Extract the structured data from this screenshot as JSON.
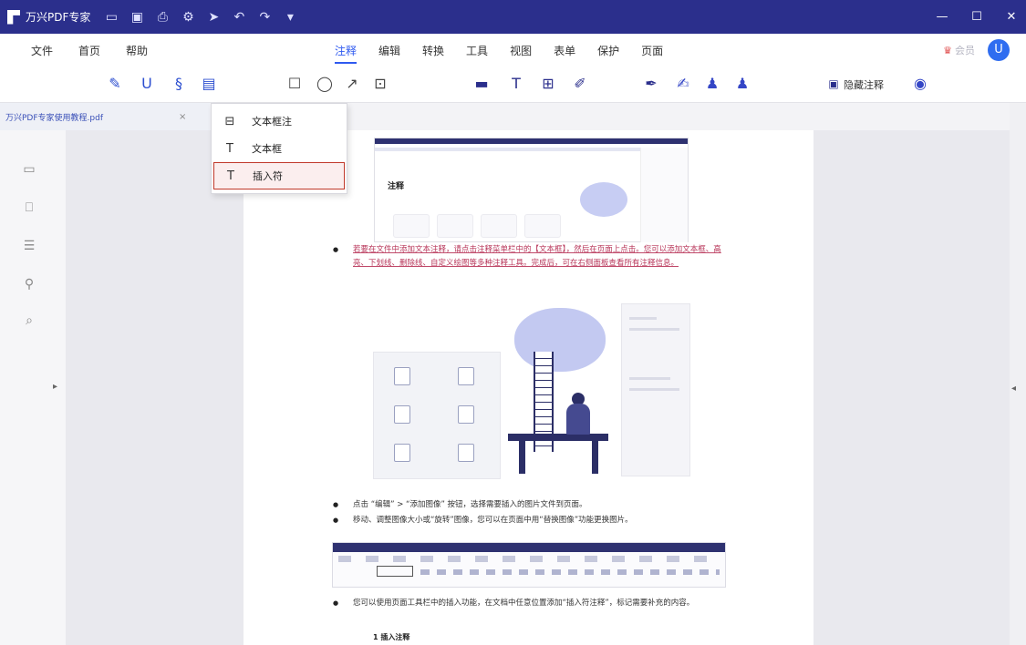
{
  "titlebar": {
    "app_name": "万兴PDF专家",
    "quick_access": [
      {
        "icon": "open-file-icon",
        "glyph": "▭"
      },
      {
        "icon": "save-icon",
        "glyph": "▣"
      },
      {
        "icon": "print-icon",
        "glyph": "⎙"
      },
      {
        "icon": "settings-icon",
        "glyph": "⚙"
      },
      {
        "icon": "share-icon",
        "glyph": "➤"
      },
      {
        "icon": "undo-icon",
        "glyph": "↶"
      },
      {
        "icon": "redo-icon",
        "glyph": "↷"
      },
      {
        "icon": "dropdown-icon",
        "glyph": "▾"
      }
    ],
    "window_controls": {
      "minimize": "—",
      "maximize": "☐",
      "close": "✕"
    }
  },
  "menubar": {
    "left": [
      "文件",
      "首页",
      "帮助"
    ],
    "tabs": [
      {
        "label": "注释",
        "active": true
      },
      {
        "label": "编辑",
        "active": false
      },
      {
        "label": "转换",
        "active": false
      },
      {
        "label": "工具",
        "active": false
      },
      {
        "label": "视图",
        "active": false
      },
      {
        "label": "表单",
        "active": false
      },
      {
        "label": "保护",
        "active": false
      },
      {
        "label": "页面",
        "active": false
      }
    ],
    "vip_label": "会员",
    "user_initial": "U"
  },
  "toolbar": {
    "icons": [
      {
        "name": "highlight-icon",
        "glyph": "✎"
      },
      {
        "name": "underline-icon",
        "glyph": "U"
      },
      {
        "name": "pen-clip-icon",
        "glyph": "§"
      },
      {
        "name": "text-note-icon",
        "glyph": "▤"
      },
      {
        "name": "rectangle-icon",
        "glyph": "☐"
      },
      {
        "name": "circle-icon",
        "glyph": "◯"
      },
      {
        "name": "arrow-icon",
        "glyph": "↗"
      },
      {
        "name": "area-icon",
        "glyph": "⊡"
      },
      {
        "name": "comment-icon",
        "glyph": "▬"
      },
      {
        "name": "text-icon",
        "glyph": "T"
      },
      {
        "name": "textbox-icon",
        "glyph": "⊞"
      },
      {
        "name": "pencil-icon",
        "glyph": "✐"
      },
      {
        "name": "marker-icon",
        "glyph": "✒"
      },
      {
        "name": "sign-icon",
        "glyph": "✍"
      },
      {
        "name": "stamp-icon",
        "glyph": "♟"
      },
      {
        "name": "stamp-menu-icon",
        "glyph": "♟"
      }
    ],
    "hide_label": "隐藏注释",
    "eye_glyph": "◉"
  },
  "file_tab": {
    "name": "万兴PDF专家使用教程.pdf",
    "close": "×"
  },
  "dropdown": {
    "items": [
      {
        "icon": "text-callout-icon",
        "glyph": "⊟",
        "label": "文本框注"
      },
      {
        "icon": "text-box-icon",
        "glyph": "T",
        "label": "文本框"
      },
      {
        "icon": "insert-text-icon",
        "glyph": "T",
        "label": "插入符",
        "selected": true
      }
    ]
  },
  "left_rail": {
    "icons": [
      {
        "name": "thumbnail-icon",
        "glyph": "▭"
      },
      {
        "name": "bookmark-icon",
        "glyph": "⎕"
      },
      {
        "name": "comments-list-icon",
        "glyph": "☰"
      },
      {
        "name": "attachment-icon",
        "glyph": "⚲"
      },
      {
        "name": "search-icon",
        "glyph": "⌕"
      }
    ],
    "collapse": "▸"
  },
  "right_strip": {
    "expand": "◂"
  },
  "document": {
    "shot1_title": "注释",
    "bullet1": "若要在文件中添加文本注释，请点击注释菜单栏中的【文本框】，然后在页面上点击。您可以添加文本框、高亮、下划线、删除线、自定义绘图等多种注释工具。完成后，可在右侧面板查看所有注释信息。",
    "bullet2": "点击 “编辑” > “添加图像” 按钮，选择需要插入的图片文件到页面。",
    "bullet3": "移动、调整图像大小或“旋转”图像，您可以在页面中用“替换图像”功能更换图片。",
    "bullet4": "您可以使用页面工具栏中的插入功能，在文档中任意位置添加“插入符注释”，标记需要补充的内容。",
    "sub_heading": "1 插入注释"
  }
}
